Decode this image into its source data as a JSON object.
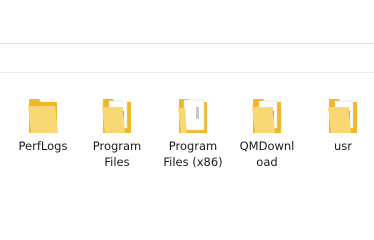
{
  "items": [
    {
      "label": "PerfLogs",
      "icon": "folder-icon"
    },
    {
      "label": "Program Files",
      "icon": "folder-icon"
    },
    {
      "label": "Program Files (x86)",
      "icon": "folder-icon"
    },
    {
      "label": "QMDownl oad",
      "icon": "folder-icon"
    },
    {
      "label": "usr",
      "icon": "folder-icon"
    }
  ],
  "colors": {
    "folder_back": "#f2b627",
    "folder_front": "#f8d775",
    "paper": "#ffffff",
    "stripe_blue": "#2d7bd6"
  }
}
